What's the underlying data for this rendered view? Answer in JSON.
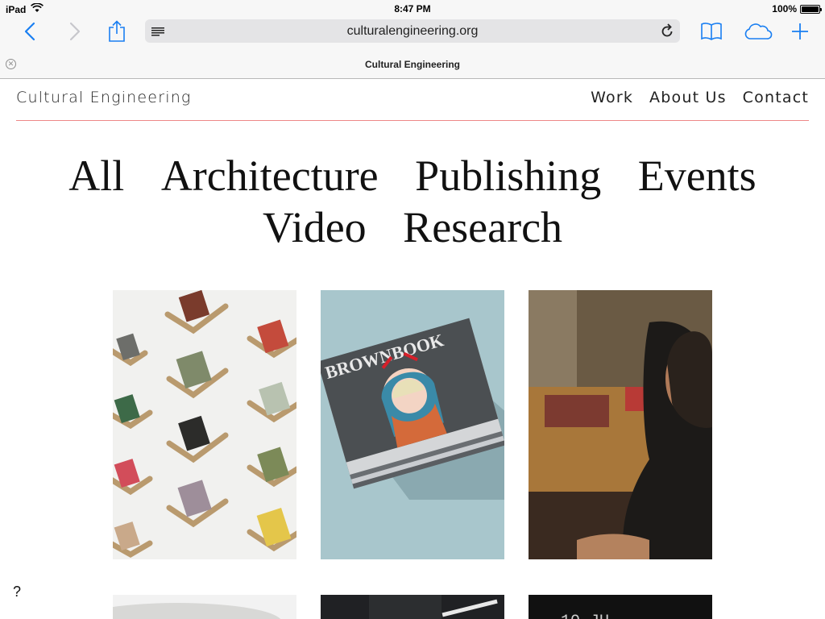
{
  "status_bar": {
    "device": "iPad",
    "time": "8:47 PM",
    "battery": "100%",
    "battery_level": 1.0
  },
  "toolbar": {
    "url": "culturalengineering.org",
    "icons": [
      "back-icon",
      "forward-icon",
      "share-icon",
      "reader-icon",
      "reload-icon",
      "bookmarks-icon",
      "icloud-tabs-icon",
      "new-tab-icon"
    ],
    "accent_color": "#1a7ff2"
  },
  "tab_bar": {
    "title": "Cultural Engineering"
  },
  "site": {
    "title": "Cultural Engineering",
    "nav": [
      {
        "label": "Work"
      },
      {
        "label": "About Us"
      },
      {
        "label": "Contact"
      }
    ],
    "categories_row1": [
      {
        "label": "All"
      },
      {
        "label": "Architecture"
      },
      {
        "label": "Publishing"
      },
      {
        "label": "Events"
      }
    ],
    "categories_row2": [
      {
        "label": "Video"
      },
      {
        "label": "Research"
      }
    ],
    "magazine_masthead": "BROWNBOOK",
    "bottom_thumb_text": "10   JU",
    "help_text": "?",
    "divider_color": "#e88888"
  }
}
